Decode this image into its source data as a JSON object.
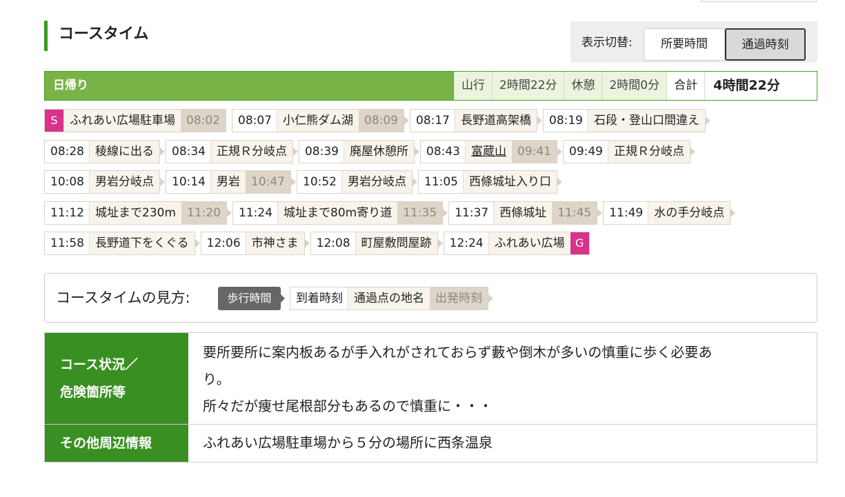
{
  "section_title": "コースタイム",
  "toggle": {
    "label": "表示切替:",
    "options": [
      "所要時間",
      "通過時刻"
    ],
    "selected": "通過時刻"
  },
  "summary": {
    "title": "日帰り",
    "climb_label": "山行",
    "climb_time": "2時間22分",
    "rest_label": "休憩",
    "rest_time": "2時間0分",
    "total_label": "合計",
    "total_time": "4時間22分"
  },
  "start_mark": "S",
  "goal_mark": "G",
  "stops": [
    {
      "arr": "",
      "name": "ふれあい広場駐車場",
      "dep": "08:02"
    },
    {
      "arr": "08:07",
      "name": "小仁熊ダム湖",
      "dep": "08:09"
    },
    {
      "arr": "08:17",
      "name": "長野道高架橋",
      "dep": ""
    },
    {
      "arr": "08:19",
      "name": "石段・登山口間違え",
      "dep": ""
    },
    {
      "arr": "08:28",
      "name": "稜線に出る",
      "dep": ""
    },
    {
      "arr": "08:34",
      "name": "正規Ｒ分岐点",
      "dep": ""
    },
    {
      "arr": "08:39",
      "name": "廃屋休憩所",
      "dep": ""
    },
    {
      "arr": "08:43",
      "name": "富蔵山",
      "dep": "09:41"
    },
    {
      "arr": "09:49",
      "name": "正規Ｒ分岐点",
      "dep": ""
    },
    {
      "arr": "10:08",
      "name": "男岩分岐点",
      "dep": ""
    },
    {
      "arr": "10:14",
      "name": "男岩",
      "dep": "10:47"
    },
    {
      "arr": "10:52",
      "name": "男岩分岐点",
      "dep": ""
    },
    {
      "arr": "11:05",
      "name": "西條城址入り口",
      "dep": ""
    },
    {
      "arr": "11:12",
      "name": "城址まで230m",
      "dep": "11:20"
    },
    {
      "arr": "11:24",
      "name": "城址まで80m寄り道",
      "dep": "11:35"
    },
    {
      "arr": "11:37",
      "name": "西條城址",
      "dep": "11:45"
    },
    {
      "arr": "11:49",
      "name": "水の手分岐点",
      "dep": ""
    },
    {
      "arr": "11:58",
      "name": "長野道下をくぐる",
      "dep": ""
    },
    {
      "arr": "12:06",
      "name": "市神さま",
      "dep": ""
    },
    {
      "arr": "12:08",
      "name": "町屋敷問屋跡",
      "dep": ""
    },
    {
      "arr": "12:24",
      "name": "ふれあい広場",
      "dep": ""
    }
  ],
  "legend": {
    "label": "コースタイムの見方:",
    "walk": "歩行時間",
    "arrive": "到着時刻",
    "place": "通過点の地名",
    "depart": "出発時刻"
  },
  "info": {
    "condition_head_1": "コース状況／",
    "condition_head_2": "危険箇所等",
    "condition_line_1": "要所要所に案内板あるが手入れがされておらず藪や倒木が多いの慎重に歩く必要あ",
    "condition_line_2": "り。",
    "condition_line_3": "所々だが痩せ尾根部分もあるので慎重に・・・",
    "other_head": "その他周辺情報",
    "other_body": "ふれあい広場駐車場から５分の場所に西条温泉"
  },
  "colors": {
    "accent_green": "#3a8f22",
    "summary_green": "#77b346",
    "mark_pink": "#d9328d"
  }
}
